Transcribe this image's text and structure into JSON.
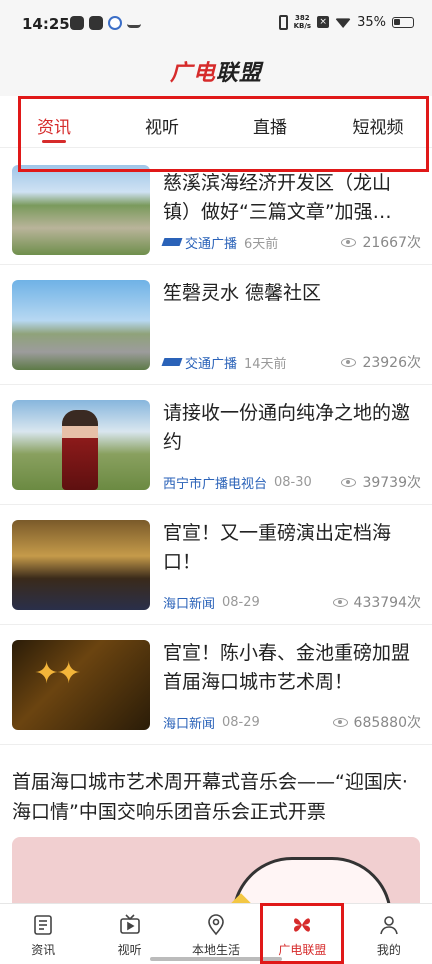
{
  "status_bar": {
    "time": "14:25",
    "net_speed_value": "382",
    "net_speed_unit": "KB/s",
    "battery": "35%"
  },
  "header": {
    "logo_part1": "广电",
    "logo_part2": "联盟"
  },
  "tabs": [
    {
      "label": "资讯",
      "active": true
    },
    {
      "label": "视听",
      "active": false
    },
    {
      "label": "直播",
      "active": false
    },
    {
      "label": "短视频",
      "active": false
    }
  ],
  "feed": [
    {
      "title": "慈溪滨海经济开发区（龙山镇）做好“三篇文章”加强…",
      "source": "交通广播",
      "time": "6天前",
      "views": "21667次"
    },
    {
      "title": "笙磬灵水 德馨社区",
      "source": "交通广播",
      "time": "14天前",
      "views": "23926次"
    },
    {
      "title": "请接收一份通向纯净之地的邀约",
      "source": "西宁市广播电视台",
      "time": "08-30",
      "views": "39739次"
    },
    {
      "title": "官宣！又一重磅演出定档海口！",
      "source": "海口新闻",
      "time": "08-29",
      "views": "433794次"
    },
    {
      "title": "官宣！陈小春、金池重磅加盟首届海口城市艺术周！",
      "source": "海口新闻",
      "time": "08-29",
      "views": "685880次"
    }
  ],
  "big_item": {
    "title": "首届海口城市艺术周开幕式音乐会——“迎国庆·海口情”中国交响乐团音乐会正式开票"
  },
  "bottom_nav": [
    {
      "label": "资讯",
      "icon": "news-icon",
      "active": false
    },
    {
      "label": "视听",
      "icon": "tv-icon",
      "active": false
    },
    {
      "label": "本地生活",
      "icon": "location-icon",
      "active": false
    },
    {
      "label": "广电联盟",
      "icon": "alliance-icon",
      "active": true
    },
    {
      "label": "我的",
      "icon": "profile-icon",
      "active": false
    }
  ],
  "colors": {
    "accent": "#d62b2b",
    "source_blue": "#2a62b8",
    "highlight_box": "#e01818"
  }
}
